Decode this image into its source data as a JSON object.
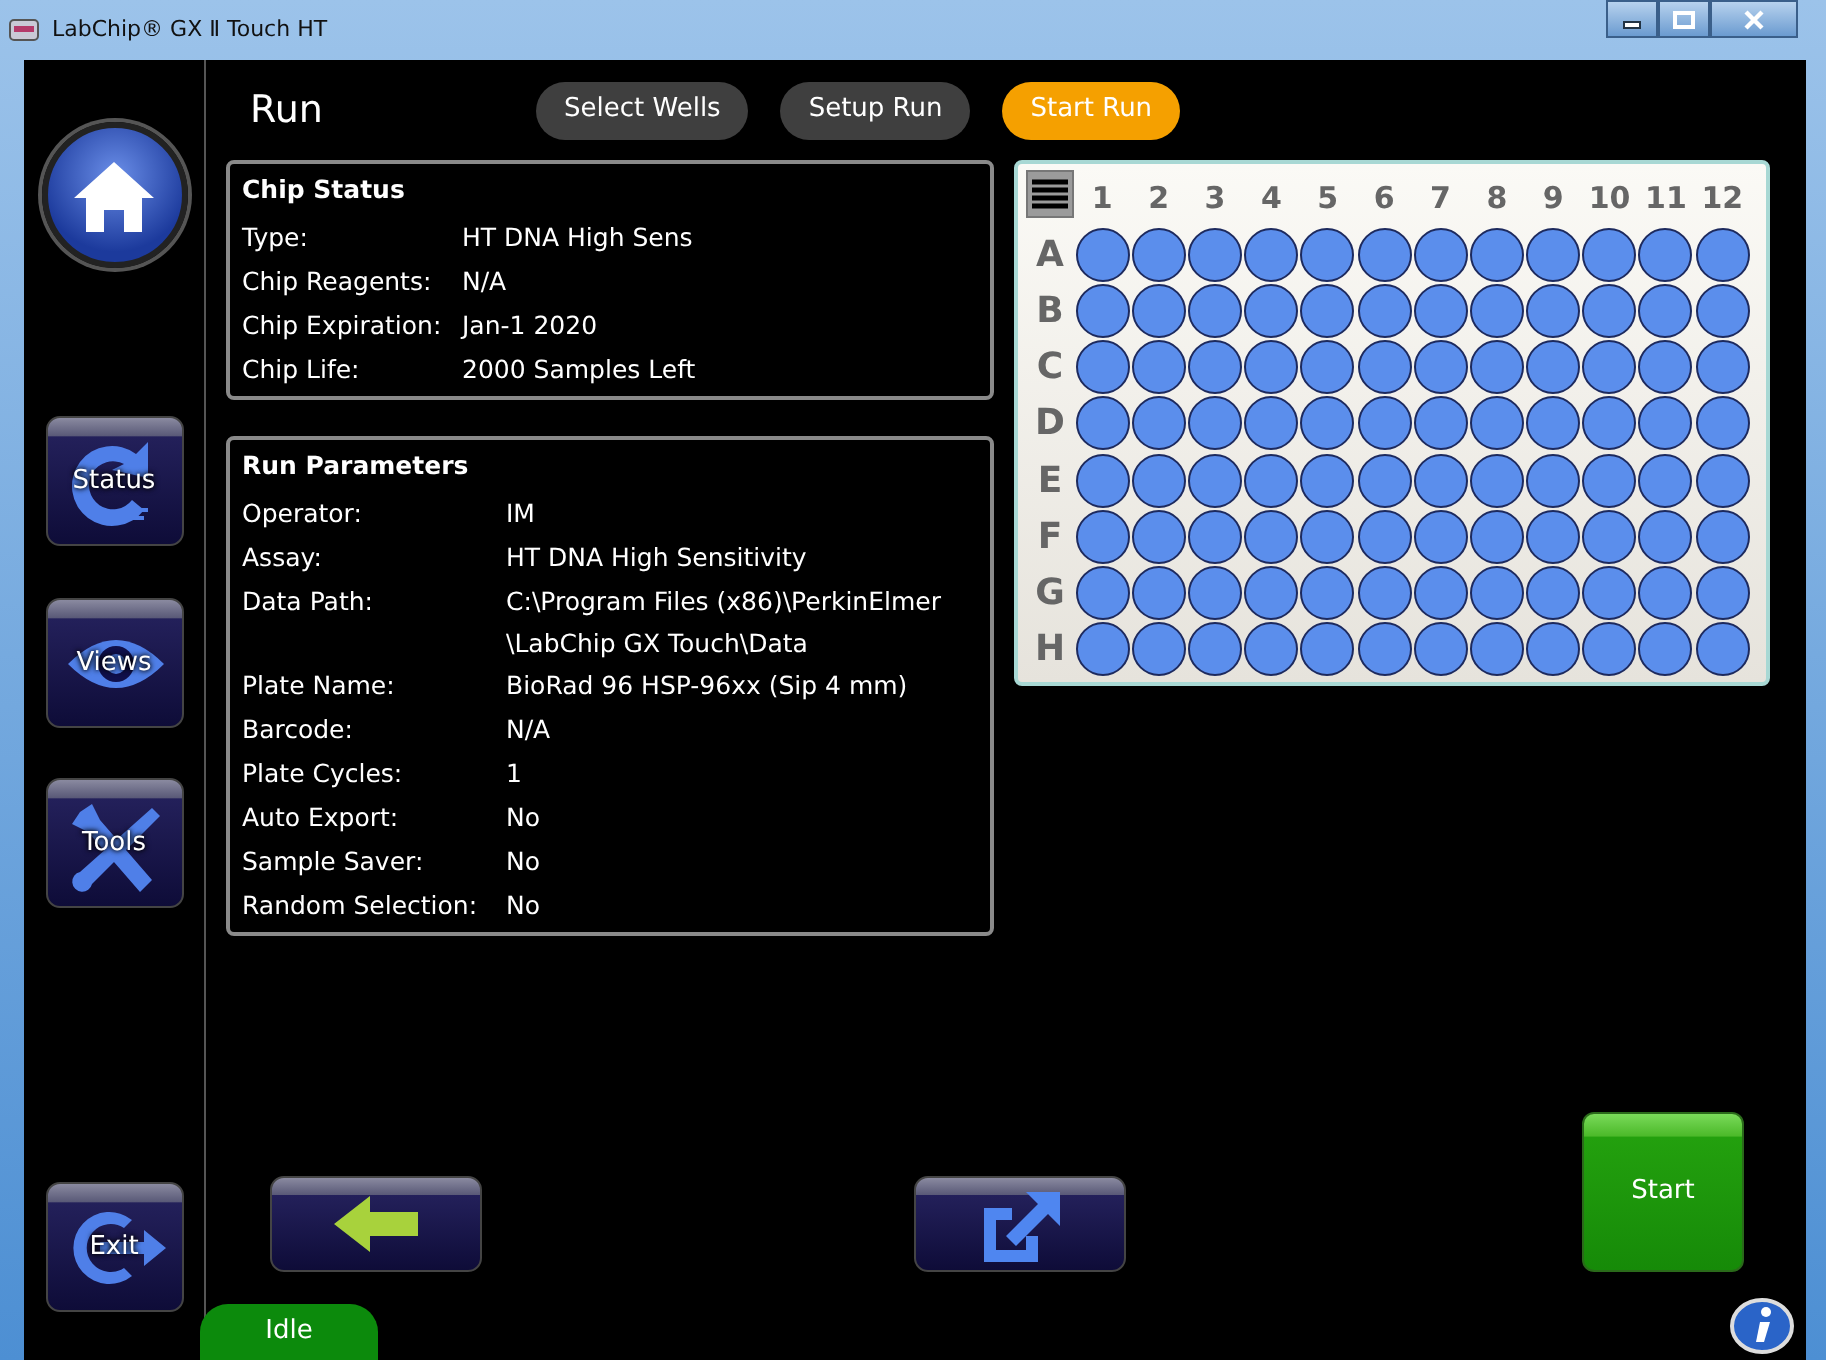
{
  "window": {
    "title": "LabChip® GX Ⅱ Touch HT"
  },
  "page_title": "Run",
  "tabs": [
    {
      "label": "Select Wells",
      "selected": false
    },
    {
      "label": "Setup Run",
      "selected": false
    },
    {
      "label": "Start Run",
      "selected": true
    }
  ],
  "sidebar": [
    {
      "kind": "home"
    },
    {
      "kind": "status",
      "label": "Status"
    },
    {
      "kind": "views",
      "label": "Views"
    },
    {
      "kind": "tools",
      "label": "Tools"
    },
    {
      "kind": "exit",
      "label": "Exit"
    }
  ],
  "chip_status": {
    "title": "Chip Status",
    "rows": [
      {
        "label": "Type:",
        "lines": [
          "HT DNA High Sens"
        ]
      },
      {
        "label": "Chip Reagents:",
        "lines": [
          "N/A"
        ]
      },
      {
        "label": "Chip Expiration:",
        "lines": [
          "Jan-1 2020"
        ]
      },
      {
        "label": "Chip Life:",
        "lines": [
          "2000 Samples Left"
        ]
      }
    ]
  },
  "run_parameters": {
    "title": "Run Parameters",
    "rows": [
      {
        "label": "Operator:",
        "lines": [
          "IM"
        ]
      },
      {
        "label": "Assay:",
        "lines": [
          "HT DNA High Sensitivity"
        ]
      },
      {
        "label": "Data Path:",
        "lines": [
          "C:\\Program Files (x86)\\PerkinElmer",
          "\\LabChip GX Touch\\Data"
        ]
      },
      {
        "label": "Plate Name:",
        "lines": [
          "BioRad 96 HSP-96xx  (Sip 4 mm)"
        ]
      },
      {
        "label": "Barcode:",
        "lines": [
          "N/A"
        ]
      },
      {
        "label": "Plate Cycles:",
        "lines": [
          "1"
        ]
      },
      {
        "label": "Auto Export:",
        "lines": [
          "No"
        ]
      },
      {
        "label": "Sample Saver:",
        "lines": [
          "No"
        ]
      },
      {
        "label": "Random Selection:",
        "lines": [
          "No"
        ]
      }
    ]
  },
  "plate": {
    "columns": [
      "1",
      "2",
      "3",
      "4",
      "5",
      "6",
      "7",
      "8",
      "9",
      "10",
      "11",
      "12"
    ],
    "rows": [
      "A",
      "B",
      "C",
      "D",
      "E",
      "F",
      "G",
      "H"
    ]
  },
  "start_button": {
    "label": "Start"
  },
  "status": {
    "label": "Idle"
  }
}
